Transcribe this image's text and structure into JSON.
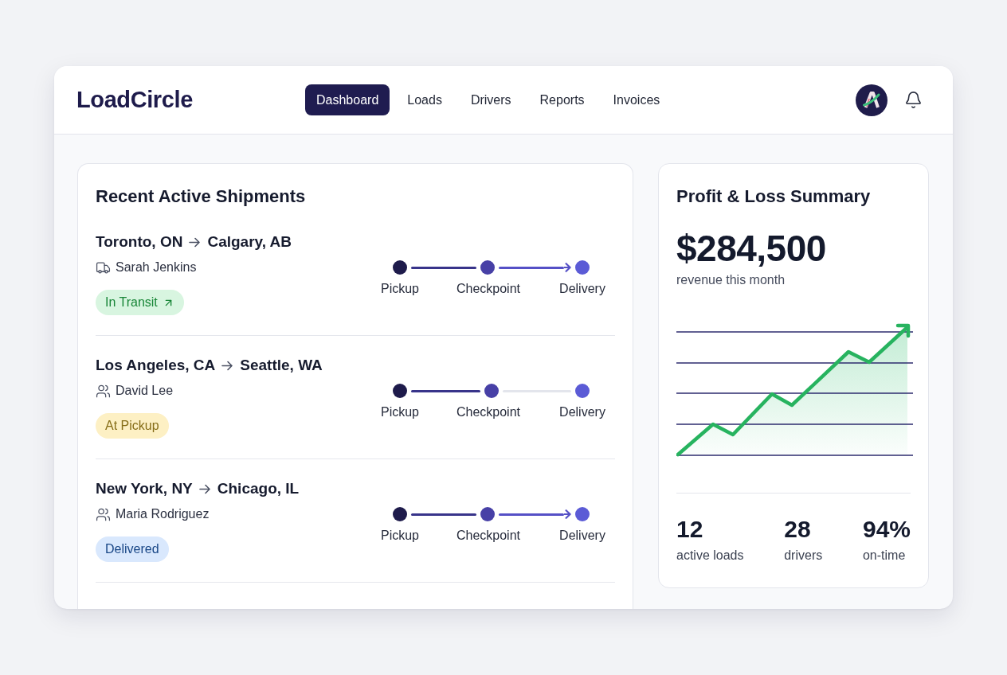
{
  "app": {
    "logo": "LoadCircle"
  },
  "nav": [
    {
      "label": "Dashboard",
      "selected": true
    },
    {
      "label": "Loads",
      "selected": false
    },
    {
      "label": "Drivers",
      "selected": false
    },
    {
      "label": "Reports",
      "selected": false
    },
    {
      "label": "Invoices",
      "selected": false
    }
  ],
  "shipments_panel": {
    "title": "Recent Active Shipments",
    "shipments": [
      {
        "origin": "Toronto, ON",
        "destination": "Calgary, AB",
        "driver": {
          "name": "Sarah Jenkins",
          "kind": "truck"
        },
        "status": {
          "label": "In Transit",
          "color": "#d8f5e0",
          "with_arrow": true
        },
        "stops": [
          "Pickup",
          "Checkpoint",
          "Delivery"
        ],
        "legs": [
          {
            "done": true
          },
          {
            "done": true
          }
        ]
      },
      {
        "origin": "Los Angeles, CA",
        "destination": "Seattle, WA",
        "driver": {
          "name": "David Lee",
          "kind": "team"
        },
        "status": {
          "label": "At Pickup",
          "color": "#fdf0c4",
          "with_arrow": false
        },
        "stops": [
          "Pickup",
          "Checkpoint",
          "Delivery"
        ],
        "legs": [
          {
            "done": true
          },
          {
            "done": false
          }
        ]
      },
      {
        "origin": "New York, NY",
        "destination": "Chicago, IL",
        "driver": {
          "name": "Maria Rodriguez",
          "kind": "team"
        },
        "status": {
          "label": "Delivered",
          "color": "#d9e8fd",
          "with_arrow": false
        },
        "stops": [
          "Pickup",
          "Checkpoint",
          "Delivery"
        ],
        "legs": [
          {
            "done": true
          },
          {
            "done": true
          }
        ]
      }
    ]
  },
  "summary": {
    "title": "Profit & Loss Summary",
    "revenue": "$284,500",
    "revenue_caption": "revenue this month",
    "stats": [
      {
        "value": "12",
        "label": "active loads"
      },
      {
        "value": "28",
        "label": "drivers"
      },
      {
        "value": "94%",
        "label": "on-time"
      }
    ]
  }
}
